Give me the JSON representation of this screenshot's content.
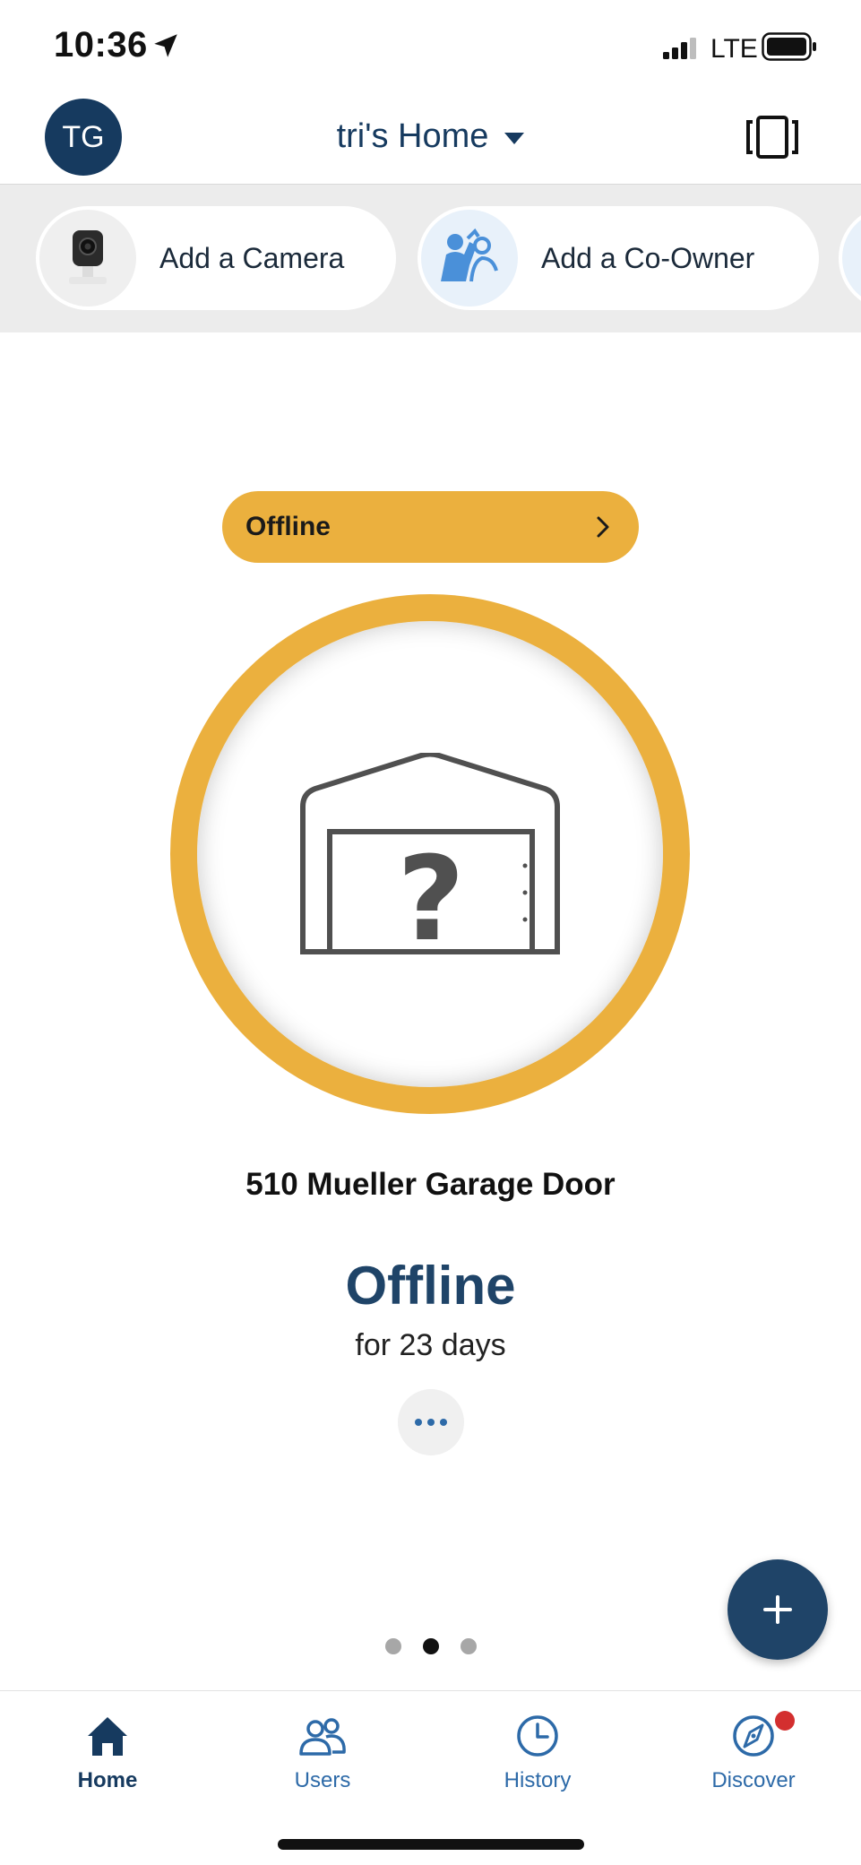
{
  "status_bar": {
    "time": "10:36",
    "network": "LTE"
  },
  "header": {
    "avatar_initials": "TG",
    "home_name": "tri's Home"
  },
  "quick_actions": [
    {
      "label": "Add a Camera",
      "icon": "camera-icon"
    },
    {
      "label": "Add a Co-Owner",
      "icon": "co-owner-icon"
    }
  ],
  "banner": {
    "label": "Offline",
    "color": "#EBB03E"
  },
  "device": {
    "name": "510 Mueller Garage Door",
    "state": "Offline",
    "duration": "for 23 days",
    "ring_color": "#EBB03E",
    "icon": "garage-unknown-icon"
  },
  "pager": {
    "count": 3,
    "active_index": 1
  },
  "tabs": [
    {
      "label": "Home",
      "icon": "home-icon",
      "active": true
    },
    {
      "label": "Users",
      "icon": "users-icon",
      "active": false
    },
    {
      "label": "History",
      "icon": "history-icon",
      "active": false
    },
    {
      "label": "Discover",
      "icon": "compass-icon",
      "active": false
    }
  ],
  "colors": {
    "primary": "#163A5F",
    "accent": "#2D6AA8",
    "warning": "#EBB03E",
    "badge": "#D32F2F"
  }
}
